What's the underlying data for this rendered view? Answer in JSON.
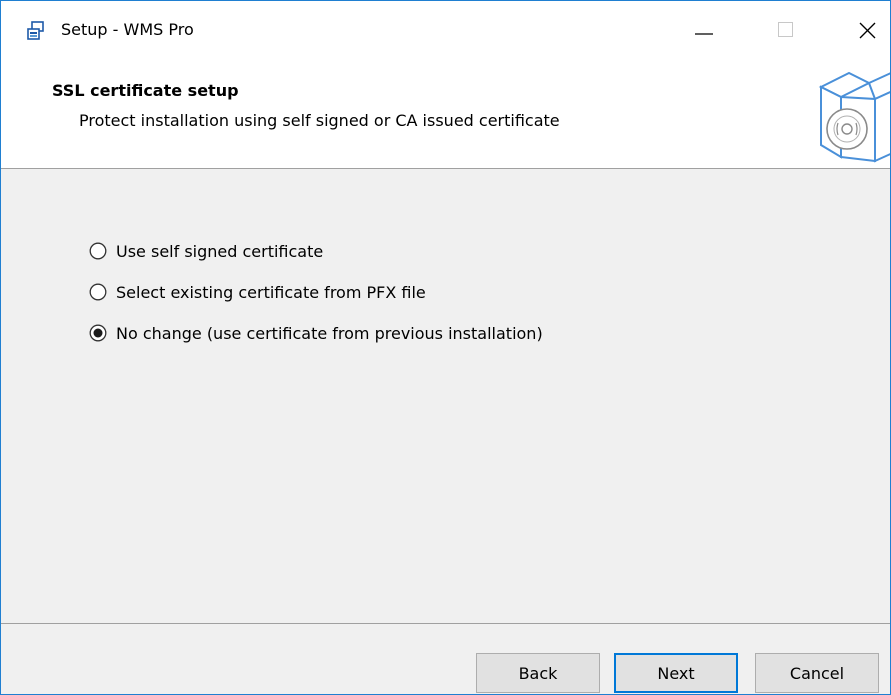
{
  "window": {
    "title": "Setup - WMS Pro",
    "app_icon": "setup-installer-icon",
    "controls": {
      "minimize_icon": "minimize-icon",
      "maximize_icon": "maximize-icon",
      "close_icon": "close-icon"
    },
    "accent_color": "#0078d7"
  },
  "header": {
    "title": "SSL certificate setup",
    "subtitle": "Protect installation using self signed or CA issued certificate",
    "graphic_icon": "software-box-disc-icon"
  },
  "options": [
    {
      "label": "Use self signed certificate",
      "selected": false
    },
    {
      "label": "Select existing certificate from PFX file",
      "selected": false
    },
    {
      "label": "No change (use certificate from previous installation)",
      "selected": true
    }
  ],
  "footer": {
    "back_label": "Back",
    "next_label": "Next",
    "cancel_label": "Cancel"
  }
}
